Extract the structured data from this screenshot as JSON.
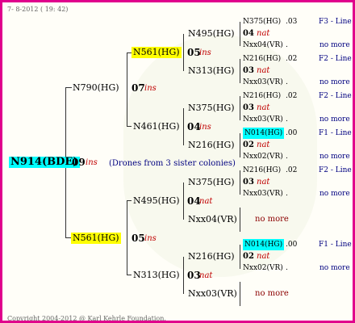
{
  "header": {
    "date_label": "7- 8-2012 ( 19: 42)"
  },
  "footer": {
    "copyright": "Copyright 2004-2012 @ Karl Kehrle Foundation."
  },
  "root": {
    "id": "N914(BDE)",
    "year": "09",
    "qual": "ins",
    "note": "(Drones from 3 sister colonies)"
  },
  "gen1": [
    {
      "id": "N790(HG)",
      "year": "07",
      "qual": "ins"
    },
    {
      "id": "N561(HG)",
      "year": "05",
      "qual": "ins"
    }
  ],
  "gen2": [
    {
      "id": "N561(HG)",
      "year": "05",
      "qual": "ins"
    },
    {
      "id": "N461(HG)",
      "year": "04",
      "qual": "ins"
    },
    {
      "id": "N495(HG)",
      "year": "04",
      "qual": "nat"
    },
    {
      "id": "N313(HG)",
      "year": "03",
      "qual": "nat"
    }
  ],
  "gen3": [
    {
      "id": "N495(HG)",
      "year": "05",
      "qual": "ins"
    },
    {
      "id": "N313(HG)",
      "year": "03",
      "qual": "nat"
    },
    {
      "id": "N375(HG)",
      "year": "04",
      "qual": "ins"
    },
    {
      "id": "N216(HG)",
      "year": "02",
      "qual": "nat"
    },
    {
      "id": "N375(HG)",
      "year": "03",
      "qual": "nat"
    },
    {
      "id": "Nxx04(VR)",
      "year": "",
      "qual": ""
    },
    {
      "id": "N216(HG)",
      "year": "02",
      "qual": "nat"
    },
    {
      "id": "Nxx03(VR)",
      "year": "",
      "qual": ""
    }
  ],
  "gen4": [
    {
      "sire": "N375(HG)",
      "sire_yr": ".03",
      "year": "04",
      "qual": "nat",
      "dam": "Nxx04(VR)",
      "dam_yr": ".",
      "line1": "F3 - Line",
      "line2": "no more"
    },
    {
      "sire": "N216(HG)",
      "sire_yr": ".02",
      "year": "03",
      "qual": "nat",
      "dam": "Nxx03(VR)",
      "dam_yr": ".",
      "line1": "F2 - Line",
      "line2": "no more"
    },
    {
      "sire": "N216(HG)",
      "sire_yr": ".02",
      "year": "03",
      "qual": "nat",
      "dam": "Nxx03(VR)",
      "dam_yr": ".",
      "line1": "F2 - Line",
      "line2": "no more"
    },
    {
      "sire": "N014(HG)",
      "sire_yr": ".00",
      "year": "02",
      "qual": "nat",
      "dam": "Nxx02(VR)",
      "dam_yr": ".",
      "line1": "F1 - Line",
      "line2": "no more"
    },
    {
      "sire": "N216(HG)",
      "sire_yr": ".02",
      "year": "03",
      "qual": "nat",
      "dam": "Nxx03(VR)",
      "dam_yr": ".",
      "line1": "F2 - Line",
      "line2": "no more"
    },
    {
      "sire": "N014(HG)",
      "sire_yr": ".00",
      "year": "02",
      "qual": "nat",
      "dam": "Nxx02(VR)",
      "dam_yr": ".",
      "line1": "F1 - Line",
      "line2": "no more"
    }
  ],
  "nomore": [
    "no more",
    "no more"
  ]
}
